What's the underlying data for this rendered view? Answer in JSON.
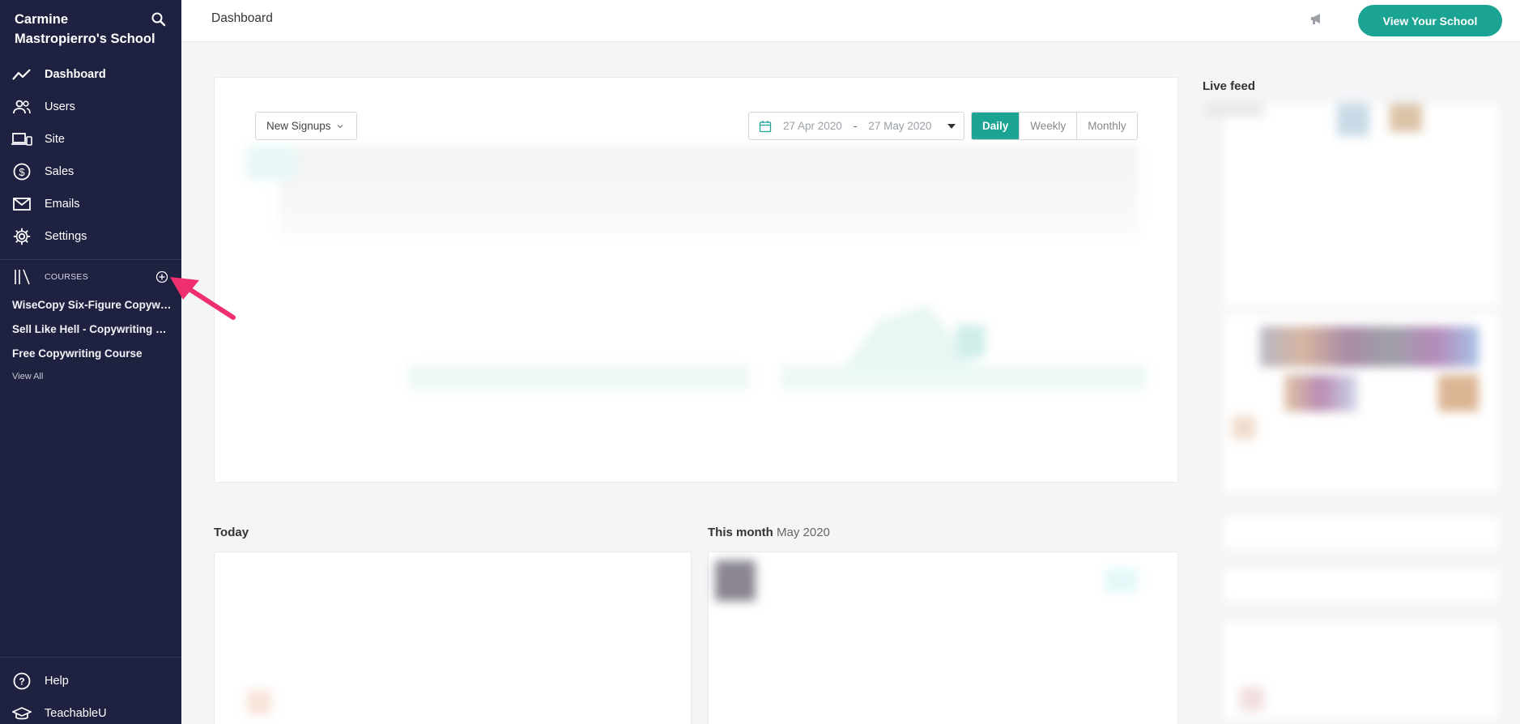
{
  "sidebar": {
    "school_name": "Carmine Mastropierro's School",
    "nav": [
      {
        "label": "Dashboard",
        "icon": "trend-line-icon",
        "active": true
      },
      {
        "label": "Users",
        "icon": "users-icon"
      },
      {
        "label": "Site",
        "icon": "devices-icon"
      },
      {
        "label": "Sales",
        "icon": "dollar-circle-icon"
      },
      {
        "label": "Emails",
        "icon": "envelope-icon"
      },
      {
        "label": "Settings",
        "icon": "gear-icon"
      }
    ],
    "courses_label": "COURSES",
    "courses": [
      "WiseCopy Six-Figure Copywriting Course",
      "Sell Like Hell - Copywriting Course",
      "Free Copywriting Course"
    ],
    "view_all": "View All",
    "bottom_nav": [
      {
        "label": "Help",
        "icon": "help-circle-icon"
      },
      {
        "label": "TeachableU",
        "icon": "graduation-cap-icon"
      }
    ]
  },
  "header": {
    "title": "Dashboard",
    "view_school_label": "View Your School"
  },
  "chart_controls": {
    "metric": "New Signups",
    "date_start": "27 Apr 2020",
    "date_sep": "-",
    "date_end": "27 May 2020",
    "periods": [
      "Daily",
      "Weekly",
      "Monthly"
    ],
    "active_period": "Daily"
  },
  "live_feed": {
    "title": "Live feed"
  },
  "sections": {
    "today": "Today",
    "this_month": "This month",
    "this_month_value": "May 2020"
  },
  "colors": {
    "sidebar_bg": "#1f2140",
    "accent": "#1ba394",
    "annotation_arrow": "#f0306e"
  }
}
